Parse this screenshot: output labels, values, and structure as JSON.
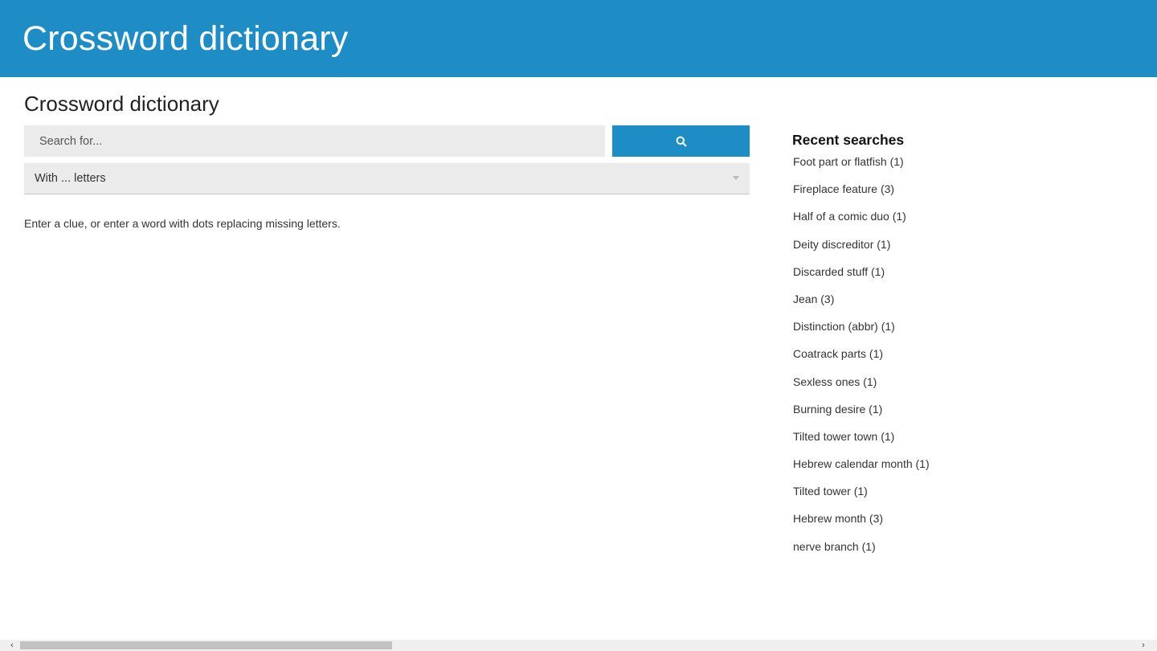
{
  "header": {
    "title": "Crossword dictionary"
  },
  "main": {
    "title": "Crossword dictionary",
    "search": {
      "placeholder": "Search for...",
      "value": ""
    },
    "search_button_icon": "search-icon",
    "letters_select": {
      "selected": "With ... letters"
    },
    "help_text": "Enter a clue, or enter a word with dots replacing missing letters."
  },
  "recent": {
    "heading": "Recent searches",
    "items": [
      {
        "label": "Foot part or flatfish (1)"
      },
      {
        "label": "Fireplace feature (3)"
      },
      {
        "label": "Half of a comic duo (1)"
      },
      {
        "label": "Deity discreditor (1)"
      },
      {
        "label": "Discarded stuff (1)"
      },
      {
        "label": "Jean (3)"
      },
      {
        "label": "Distinction (abbr) (1)"
      },
      {
        "label": "Coatrack parts (1)"
      },
      {
        "label": "Sexless ones (1)"
      },
      {
        "label": "Burning desire (1)"
      },
      {
        "label": "Tilted tower town (1)"
      },
      {
        "label": "Hebrew calendar month (1)"
      },
      {
        "label": "Tilted tower (1)"
      },
      {
        "label": "Hebrew month (3)"
      },
      {
        "label": "nerve branch (1)"
      }
    ]
  },
  "scrollbar": {
    "left_arrow": "‹",
    "right_arrow": "›"
  },
  "colors": {
    "brand": "#1e8dc6",
    "field_bg": "#ebebeb",
    "text": "#333333"
  }
}
